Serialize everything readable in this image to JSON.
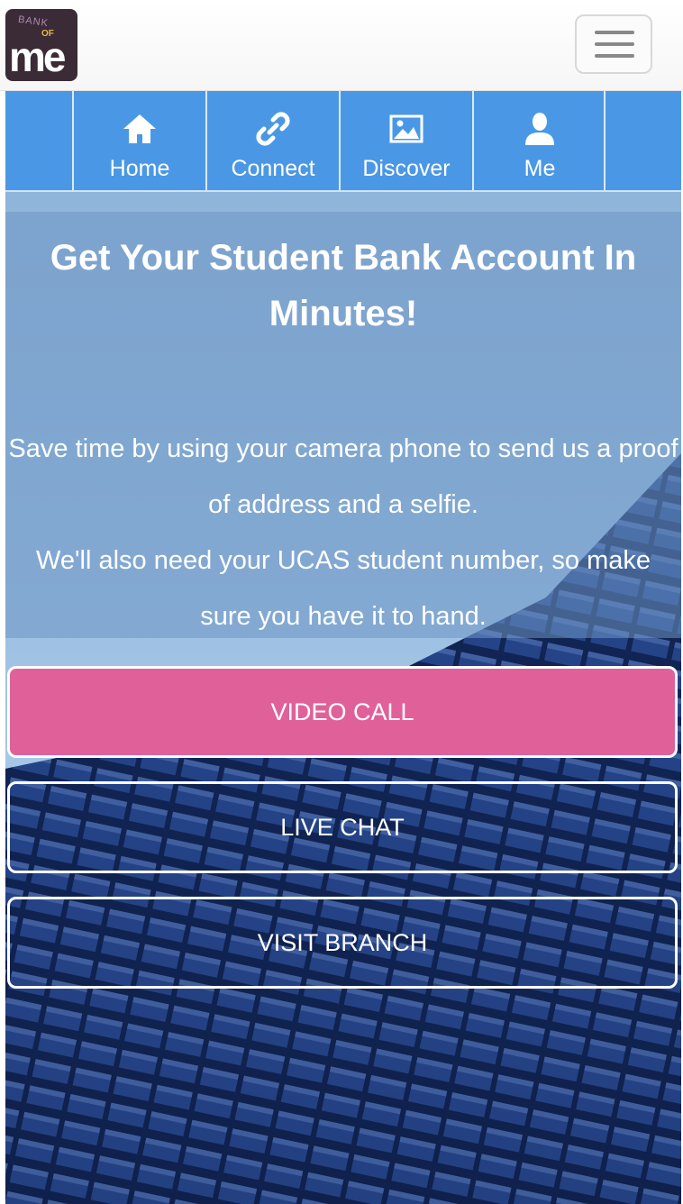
{
  "header": {
    "logo": {
      "line1": "BANK",
      "line2": "OF",
      "line3": "me"
    },
    "menu_icon": "hamburger-icon"
  },
  "nav": {
    "items": [
      {
        "label": "Home",
        "icon": "home-icon"
      },
      {
        "label": "Connect",
        "icon": "link-icon"
      },
      {
        "label": "Discover",
        "icon": "image-icon"
      },
      {
        "label": "Me",
        "icon": "user-icon"
      }
    ]
  },
  "hero": {
    "title": "Get Your Student Bank Account In Minutes!",
    "body_line1": "Save time by using your camera phone to send us a proof of address and a selfie.",
    "body_line2": "We'll also need your UCAS student number, so make sure you have it to hand."
  },
  "actions": {
    "video_call": "VIDEO CALL",
    "live_chat": "LIVE CHAT",
    "visit_branch": "VISIT BRANCH"
  },
  "colors": {
    "nav_bg": "#4a98e5",
    "video_call_bg": "#e0619a",
    "building_dark": "#0e1f4a"
  }
}
